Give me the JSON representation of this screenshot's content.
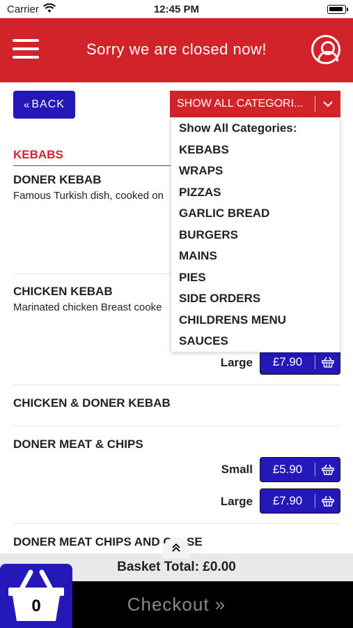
{
  "status_bar": {
    "carrier": "Carrier",
    "time": "12:45 PM"
  },
  "header": {
    "title": "Sorry we are closed now!"
  },
  "back_button": {
    "label": "BACK",
    "icon": "double-chevron-left-icon"
  },
  "category_select": {
    "selected": "SHOW ALL CATEGORI...",
    "options": [
      "Show All Categories:",
      "KEBABS",
      "WRAPS",
      "PIZZAS",
      "GARLIC BREAD",
      "BURGERS",
      "MAINS",
      "PIES",
      "SIDE ORDERS",
      "CHILDRENS MENU",
      "SAUCES"
    ]
  },
  "section": {
    "title": "KEBABS"
  },
  "items": [
    {
      "name": "DONER KEBAB",
      "description": "Famous Turkish dish, cooked on"
    },
    {
      "name": "CHICKEN KEBAB",
      "description": "Marinated chicken Breast cooke",
      "prices": [
        {
          "size": "Large",
          "price": "£7.90"
        }
      ]
    },
    {
      "name": "CHICKEN & DONER KEBAB"
    },
    {
      "name": "DONER MEAT & CHIPS",
      "prices": [
        {
          "size": "Small",
          "price": "£5.90"
        },
        {
          "size": "Large",
          "price": "£7.90"
        }
      ]
    },
    {
      "name": "DONER MEAT CHIPS AND C",
      "name_tail": "SE"
    }
  ],
  "basket": {
    "total_label": "Basket Total: £0.00",
    "count": "0"
  },
  "checkout": {
    "label": "Checkout",
    "chevron": "»"
  },
  "colors": {
    "brand_red": "#d3232a",
    "button_blue": "#2518b8",
    "checkout_bg": "#000000"
  }
}
